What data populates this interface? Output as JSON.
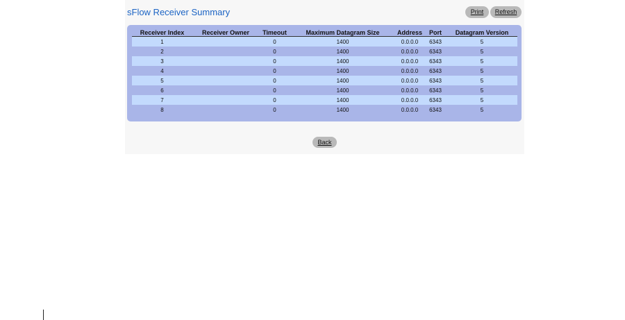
{
  "page": {
    "title": "sFlow Receiver Summary"
  },
  "toolbar": {
    "print_label": "Print",
    "refresh_label": "Refresh"
  },
  "table": {
    "headers": [
      "Receiver Index",
      "Receiver Owner",
      "Timeout",
      "Maximum Datagram Size",
      "Address",
      "Port",
      "Datagram Version"
    ],
    "rows": [
      [
        "1",
        "",
        "0",
        "1400",
        "0.0.0.0",
        "6343",
        "5"
      ],
      [
        "2",
        "",
        "0",
        "1400",
        "0.0.0.0",
        "6343",
        "5"
      ],
      [
        "3",
        "",
        "0",
        "1400",
        "0.0.0.0",
        "6343",
        "5"
      ],
      [
        "4",
        "",
        "0",
        "1400",
        "0.0.0.0",
        "6343",
        "5"
      ],
      [
        "5",
        "",
        "0",
        "1400",
        "0.0.0.0",
        "6343",
        "5"
      ],
      [
        "6",
        "",
        "0",
        "1400",
        "0.0.0.0",
        "6343",
        "5"
      ],
      [
        "7",
        "",
        "0",
        "1400",
        "0.0.0.0",
        "6343",
        "5"
      ],
      [
        "8",
        "",
        "0",
        "1400",
        "0.0.0.0",
        "6343",
        "5"
      ]
    ]
  },
  "footer": {
    "back_label": "Back"
  }
}
